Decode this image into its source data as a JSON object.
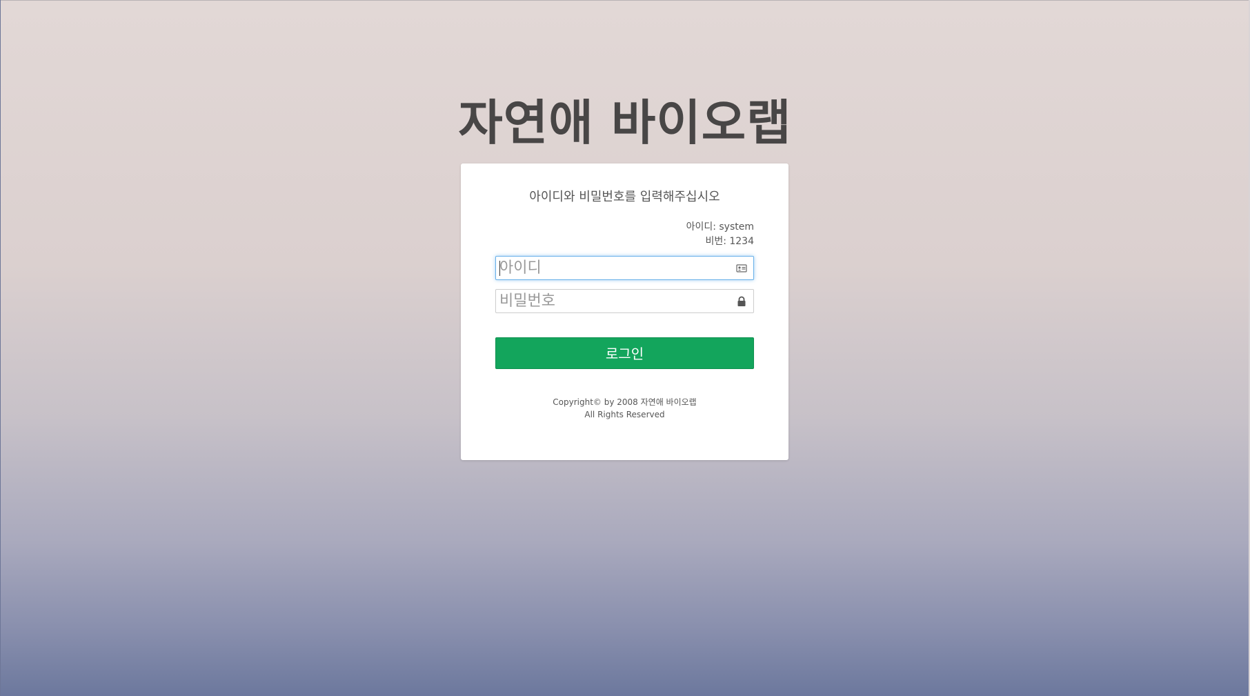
{
  "page": {
    "brand_title": "자연애 바이오랩"
  },
  "login": {
    "prompt": "아이디와 비밀번호를 입력해주십시오",
    "hint_id": "아이디: system",
    "hint_pw": "비번: 1234",
    "id_field": {
      "placeholder": "아이디",
      "value": "",
      "icon": "id-card-icon"
    },
    "password_field": {
      "placeholder": "비밀번호",
      "value": "",
      "icon": "lock-icon"
    },
    "submit_label": "로그인",
    "submit_color": "#13a55c"
  },
  "footer": {
    "copyright_line1": "Copyright© by 2008 자연애 바이오랩",
    "copyright_line2": "All Rights Reserved"
  }
}
